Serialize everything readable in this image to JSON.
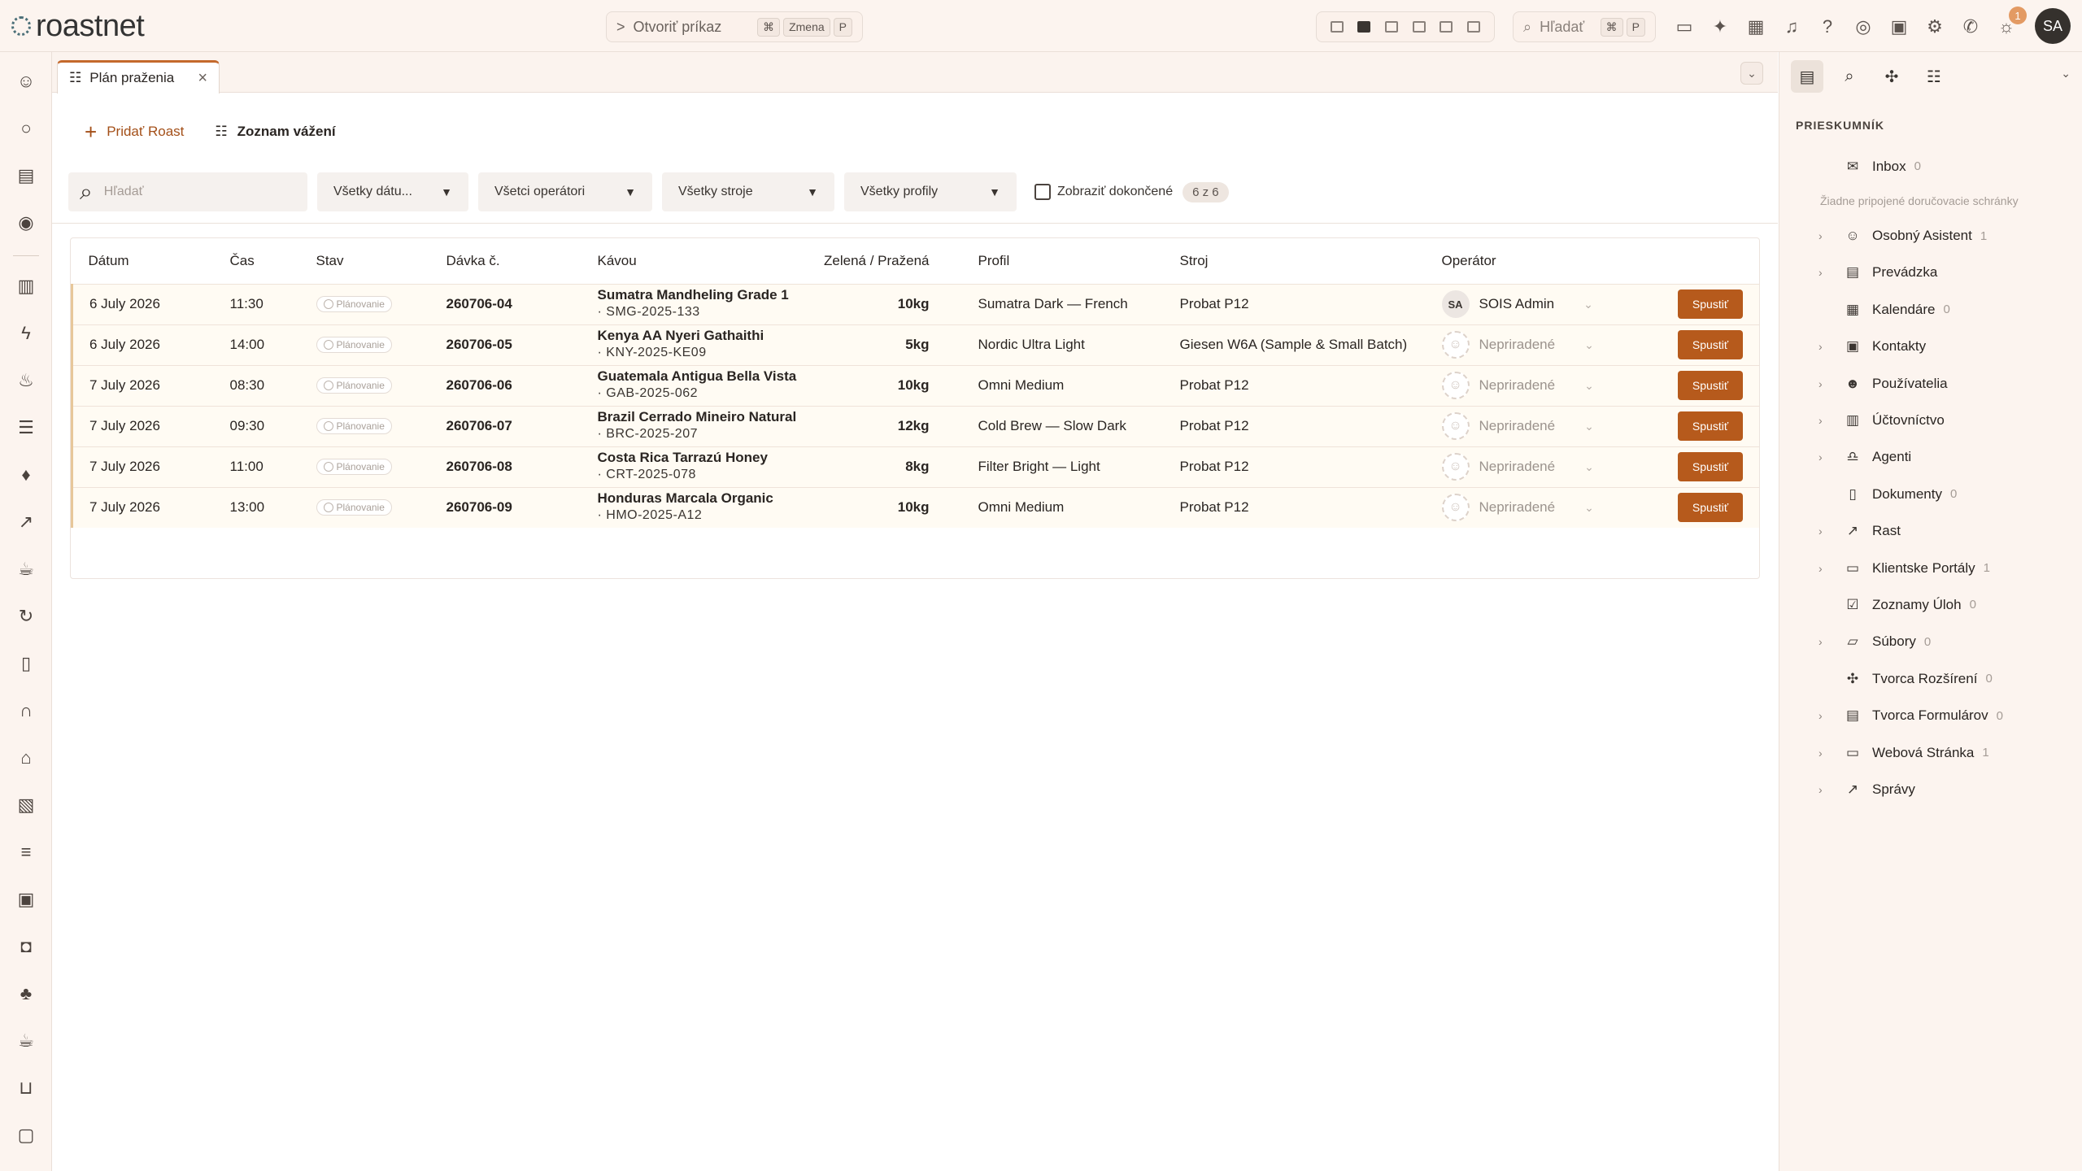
{
  "app": {
    "logo_text": "roastnet"
  },
  "topbar": {
    "command_label": "Otvoriť príkaz",
    "command_prefix": ">",
    "command_keys": [
      "⌘",
      "Zmena",
      "P"
    ],
    "search_placeholder": "Hľadať",
    "search_keys": [
      "⌘",
      "P"
    ],
    "notification_count": "1",
    "user_initials": "SA"
  },
  "tab": {
    "label": "Plán praženia"
  },
  "actions": {
    "add_roast": "Pridať Roast",
    "weighing_list": "Zoznam vážení"
  },
  "filters": {
    "search_placeholder": "Hľadať",
    "dates": "Všetky dátu...",
    "operators": "Všetci operátori",
    "machines": "Všetky stroje",
    "profiles": "Všetky profily",
    "show_completed": "Zobraziť dokončené",
    "count": "6 z 6"
  },
  "table": {
    "headers": [
      "Dátum",
      "Čas",
      "Stav",
      "Dávka č.",
      "Kávou",
      "Zelená / Pražená",
      "Profil",
      "Stroj",
      "Operátor"
    ],
    "run_label": "Spustiť",
    "rows": [
      {
        "date": "6 July 2026",
        "time": "11:30",
        "status": "Plánovanie",
        "batch": "260706-04",
        "coffee": "Sumatra Mandheling Grade 1",
        "code": "· SMG-2025-133",
        "weight": "10kg",
        "profile": "Sumatra Dark — French",
        "machine": "Probat P12",
        "operator": "SOIS Admin",
        "operator_initials": "SA"
      },
      {
        "date": "6 July 2026",
        "time": "14:00",
        "status": "Plánovanie",
        "batch": "260706-05",
        "coffee": "Kenya AA Nyeri Gathaithi",
        "code": "· KNY-2025-KE09",
        "weight": "5kg",
        "profile": "Nordic Ultra Light",
        "machine": "Giesen W6A (Sample & Small Batch)",
        "operator": "Nepriradené",
        "operator_initials": ""
      },
      {
        "date": "7 July 2026",
        "time": "08:30",
        "status": "Plánovanie",
        "batch": "260706-06",
        "coffee": "Guatemala Antigua Bella Vista",
        "code": "· GAB-2025-062",
        "weight": "10kg",
        "profile": "Omni Medium",
        "machine": "Probat P12",
        "operator": "Nepriradené",
        "operator_initials": ""
      },
      {
        "date": "7 July 2026",
        "time": "09:30",
        "status": "Plánovanie",
        "batch": "260706-07",
        "coffee": "Brazil Cerrado Mineiro Natural",
        "code": "· BRC-2025-207",
        "weight": "12kg",
        "profile": "Cold Brew — Slow Dark",
        "machine": "Probat P12",
        "operator": "Nepriradené",
        "operator_initials": ""
      },
      {
        "date": "7 July 2026",
        "time": "11:00",
        "status": "Plánovanie",
        "batch": "260706-08",
        "coffee": "Costa Rica Tarrazú Honey",
        "code": "· CRT-2025-078",
        "weight": "8kg",
        "profile": "Filter Bright — Light",
        "machine": "Probat P12",
        "operator": "Nepriradené",
        "operator_initials": ""
      },
      {
        "date": "7 July 2026",
        "time": "13:00",
        "status": "Plánovanie",
        "batch": "260706-09",
        "coffee": "Honduras Marcala Organic",
        "code": "· HMO-2025-A12",
        "weight": "10kg",
        "profile": "Omni Medium",
        "machine": "Probat P12",
        "operator": "Nepriradené",
        "operator_initials": ""
      }
    ]
  },
  "explorer": {
    "title": "PRIESKUMNÍK",
    "no_mailbox_note": "Žiadne pripojené doručovacie schránky",
    "items": [
      {
        "label": "Inbox",
        "count": "0",
        "expandable": false,
        "icon": "mail-icon"
      },
      {
        "label": "Osobný Asistent",
        "count": "1",
        "expandable": true,
        "icon": "bot-icon"
      },
      {
        "label": "Prevádzka",
        "count": "",
        "expandable": true,
        "icon": "building-icon"
      },
      {
        "label": "Kalendáre",
        "count": "0",
        "expandable": false,
        "icon": "calendar-icon"
      },
      {
        "label": "Kontakty",
        "count": "",
        "expandable": true,
        "icon": "contacts-icon"
      },
      {
        "label": "Používatelia",
        "count": "",
        "expandable": true,
        "icon": "users-icon"
      },
      {
        "label": "Účtovníctvo",
        "count": "",
        "expandable": true,
        "icon": "calculator-icon"
      },
      {
        "label": "Agenti",
        "count": "",
        "expandable": true,
        "icon": "agent-icon"
      },
      {
        "label": "Dokumenty",
        "count": "0",
        "expandable": false,
        "icon": "document-icon"
      },
      {
        "label": "Rast",
        "count": "",
        "expandable": true,
        "icon": "chart-icon"
      },
      {
        "label": "Klientske Portály",
        "count": "1",
        "expandable": true,
        "icon": "portal-icon"
      },
      {
        "label": "Zoznamy Úloh",
        "count": "0",
        "expandable": false,
        "icon": "tasks-icon"
      },
      {
        "label": "Súbory",
        "count": "0",
        "expandable": true,
        "icon": "folder-icon"
      },
      {
        "label": "Tvorca Rozšírení",
        "count": "0",
        "expandable": false,
        "icon": "extension-icon"
      },
      {
        "label": "Tvorca Formulárov",
        "count": "0",
        "expandable": true,
        "icon": "form-icon"
      },
      {
        "label": "Webová Stránka",
        "count": "1",
        "expandable": true,
        "icon": "browser-icon"
      },
      {
        "label": "Správy",
        "count": "",
        "expandable": true,
        "icon": "reports-icon"
      }
    ]
  }
}
